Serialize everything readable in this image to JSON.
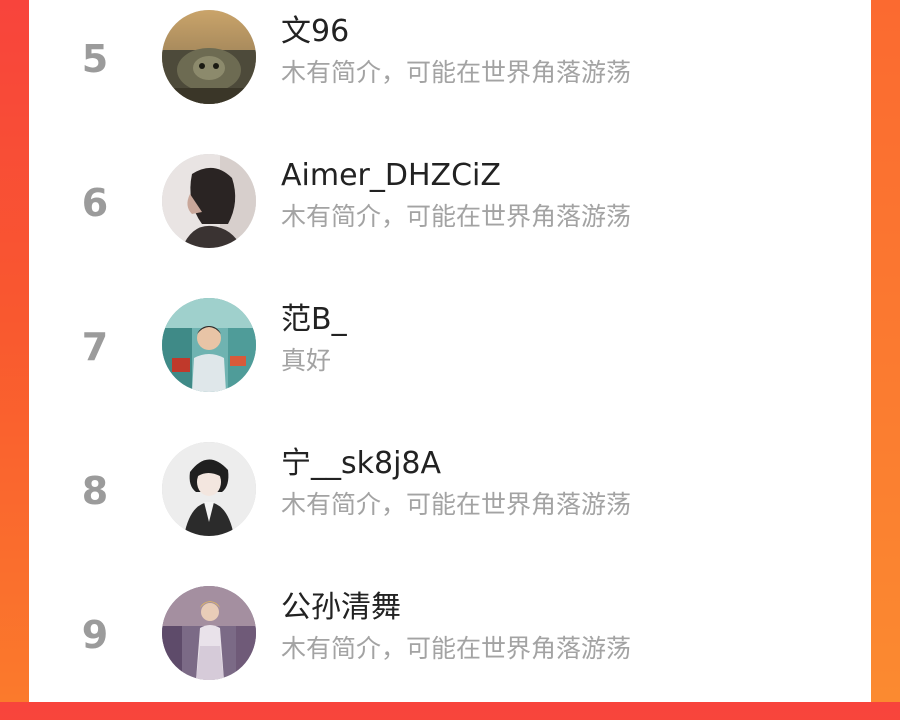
{
  "rank_list": {
    "items": [
      {
        "rank": "5",
        "name": "文96",
        "bio": "木有简介，可能在世界角落游荡",
        "avatar": "turtle-avatar"
      },
      {
        "rank": "6",
        "name": "Aimer_DHZCiZ",
        "bio": "木有简介，可能在世界角落游荡",
        "avatar": "girl-profile-avatar"
      },
      {
        "rank": "7",
        "name": "范B_",
        "bio": "真好",
        "avatar": "child-photo-avatar"
      },
      {
        "rank": "8",
        "name": "宁__sk8j8A",
        "bio": "木有简介，可能在世界角落游荡",
        "avatar": "anime-boy-avatar"
      },
      {
        "rank": "9",
        "name": "公孙清舞",
        "bio": "木有简介，可能在世界角落游荡",
        "avatar": "woman-dress-avatar"
      }
    ]
  },
  "colors": {
    "background": "#f8443c",
    "rank_text": "#9b9b9b",
    "name_text": "#222222",
    "bio_text": "#a3a3a3"
  }
}
